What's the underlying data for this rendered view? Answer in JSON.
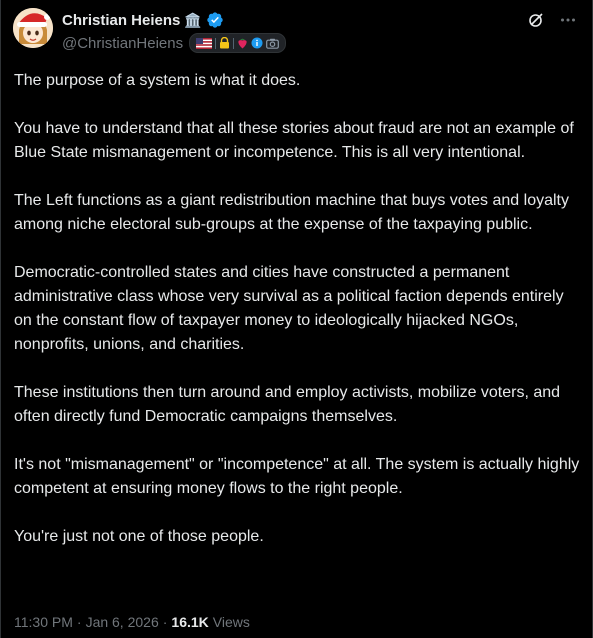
{
  "author": {
    "display_name": "Christian Heiens",
    "handle": "@ChristianHeiens",
    "name_emoji": "🏛️",
    "verified": true,
    "avatar_icon": "santa-hat-avatar-icon"
  },
  "badges": [
    "us-flag-icon",
    "lock-icon",
    "strawberry-icon",
    "info-icon",
    "camera-icon"
  ],
  "top_actions": [
    "grok-icon",
    "more-icon"
  ],
  "post": {
    "paragraphs": [
      "The purpose of a system is what it does.",
      "You have to understand that all these stories about fraud are not an example of Blue State mismanagement or incompetence. This is all very intentional.",
      "The Left functions as a giant redistribution machine that buys votes and loyalty among niche electoral sub-groups at the expense of the taxpaying public.",
      "Democratic-controlled states and cities have constructed a permanent administrative class whose very survival as a political faction depends entirely on the constant flow of taxpayer money to ideologically hijacked NGOs, nonprofits, unions, and charities.",
      "These institutions then turn around and employ activists, mobilize voters, and often directly fund Democratic campaigns themselves.",
      "It's not \"mismanagement\" or \"incompetence\" at all. The system is actually highly competent at ensuring money flows to the right people.",
      "You're just not one of those people."
    ]
  },
  "meta": {
    "time": "11:30 PM",
    "separator": "·",
    "date": "Jan 6, 2026",
    "views_count": "16.1K",
    "views_label": "Views"
  },
  "colors": {
    "background": "#000000",
    "text_primary": "#e7e9ea",
    "text_secondary": "#71767b",
    "verified_blue": "#1d9bf0"
  }
}
